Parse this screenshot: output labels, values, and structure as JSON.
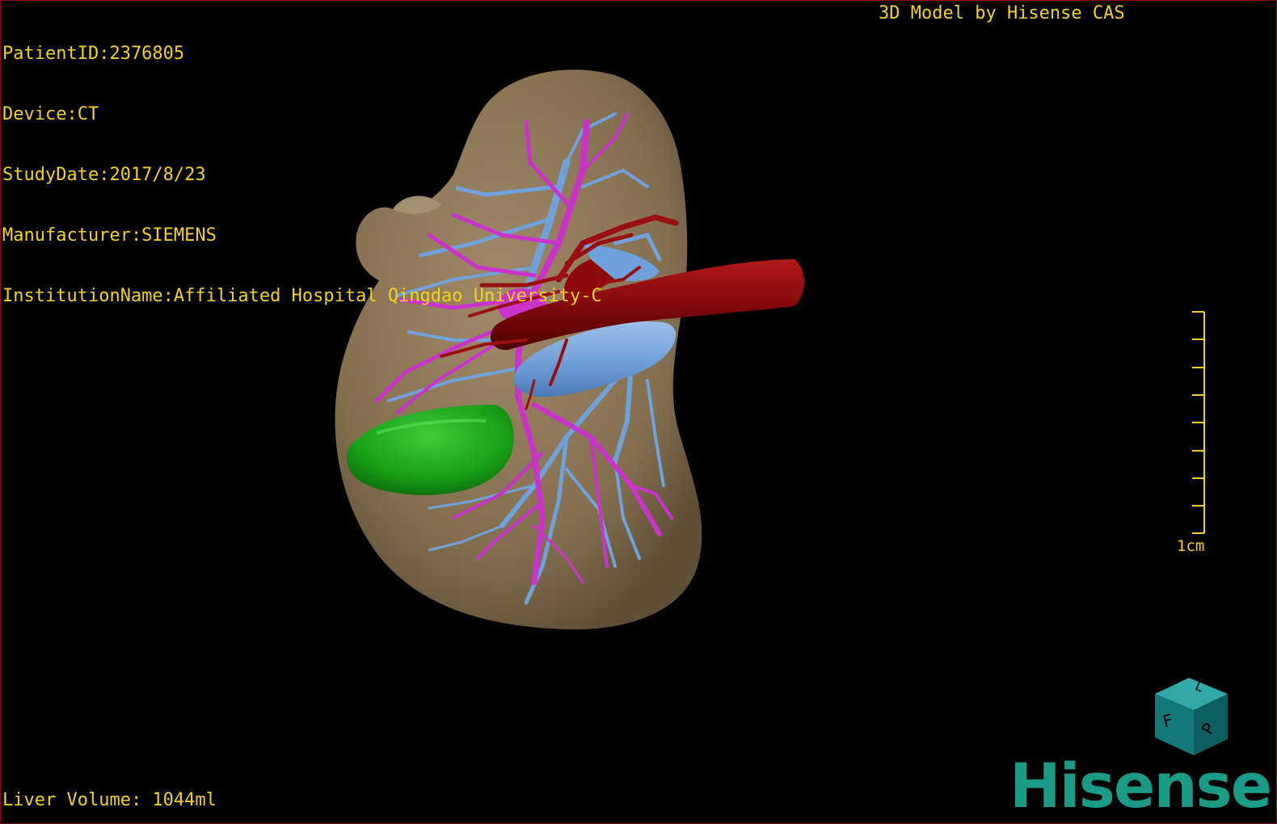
{
  "overlay": {
    "patient_id": "PatientID:2376805",
    "device": "Device:CT",
    "study_date": "StudyDate:2017/8/23",
    "manufacturer": "Manufacturer:SIEMENS",
    "institution": "InstitutionName:Affiliated Hospital Qingdao University-C",
    "brand_title": "3D Model by Hisense CAS",
    "liver_volume": "Liver Volume: 1044ml",
    "scale_label": "1cm"
  },
  "orientation_cube": {
    "face_letters": [
      "F",
      "L",
      "P"
    ]
  },
  "logo": {
    "text": "Hisense",
    "color": "#1a9b86"
  },
  "colors": {
    "text": "#f2d21b",
    "liver": "#8f7a5b",
    "portal_vein": "#cc33cc",
    "hepatic_vein": "#6fa1dc",
    "artery": "#8e0a0a",
    "gallbladder": "#1ea51e",
    "border": "#8a0a14"
  }
}
